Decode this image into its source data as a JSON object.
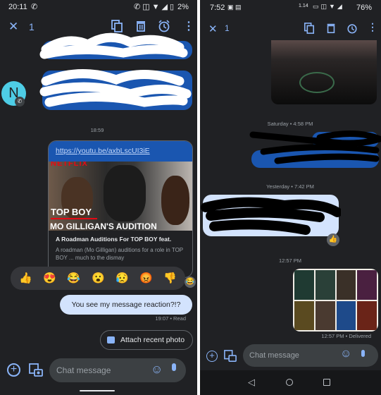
{
  "left": {
    "status": {
      "time": "20:11",
      "battery": "2%"
    },
    "toolbar": {
      "count": "1",
      "icons": [
        "close-icon",
        "copy-icon",
        "delete-icon",
        "alarm-icon",
        "more-icon"
      ]
    },
    "avatar_letter": "N",
    "timestamp1": "18:59",
    "link_card": {
      "url": "https://youtu.be/axbLscUI3iE",
      "thumb_brand": "NETFLIX",
      "thumb_title": "TOP BOY",
      "thumb_subtitle": "MO GILLIGAN'S AUDITION",
      "title": "A Roadman Auditions For TOP BOY feat.",
      "description": "A roadman (Mo Gilligan) auditions for a role in TOP BOY ... much to the dismay"
    },
    "reactions": [
      "👍",
      "😍",
      "😂",
      "😮",
      "😥",
      "😡",
      "👎"
    ],
    "reaction_badge": "😂",
    "sent_message": "You see my message reaction?!?",
    "sent_status": "19:07 • Read",
    "attach_button": "Attach recent photo",
    "compose_placeholder": "Chat message"
  },
  "right": {
    "status": {
      "time": "7:52",
      "battery": "76%",
      "speed": "1.14"
    },
    "toolbar": {
      "count": "1"
    },
    "timestamp1": "Saturday • 4:58 PM",
    "timestamp2": "Yesterday • 7:42 PM",
    "reaction_badge": "👍",
    "timestamp3": "12:57 PM",
    "sent_status": "12:57 PM • Delivered",
    "compose_placeholder": "Chat message"
  },
  "colors": {
    "background": "#202124",
    "accent": "#8ab4f8",
    "sent_bubble": "#d3e3fd",
    "outgoing_blue": "#1a56b0"
  }
}
